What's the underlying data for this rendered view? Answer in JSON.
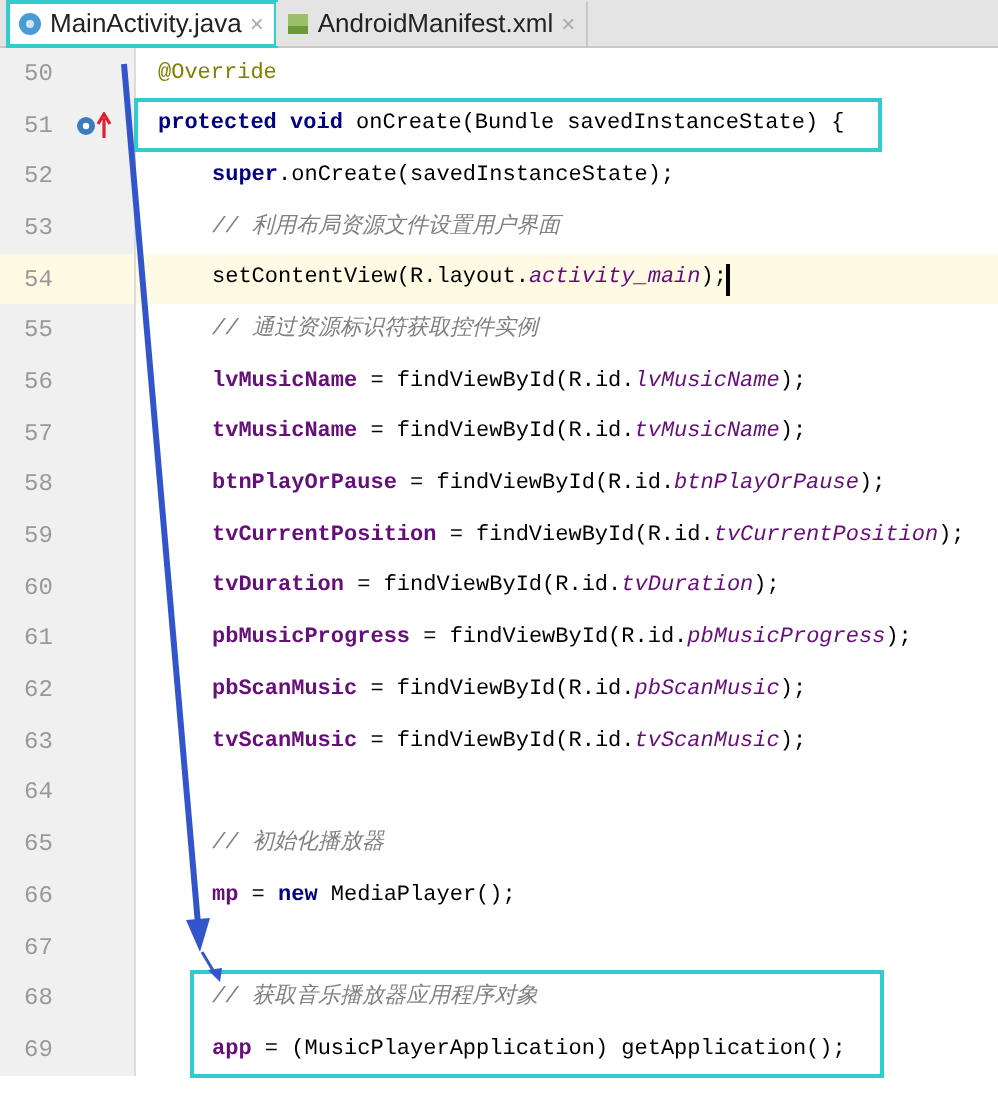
{
  "tabs": [
    {
      "label": "MainActivity.java",
      "close": "×",
      "kind": "java",
      "selected": true,
      "boxed": true
    },
    {
      "label": "AndroidManifest.xml",
      "close": "×",
      "kind": "manifest",
      "selected": false,
      "boxed": false
    }
  ],
  "lines": [
    {
      "number": "50",
      "kind": "declaration",
      "tokens": [
        {
          "text": "@Override",
          "kind": "annotation"
        }
      ]
    },
    {
      "number": "51",
      "kind": "declaration",
      "boxed": true,
      "override_marker": true,
      "tokens": [
        {
          "text": "protected void",
          "kind": "keyword"
        },
        {
          "text": " onCreate(Bundle savedInstanceState) {",
          "kind": "plain"
        }
      ]
    },
    {
      "number": "52",
      "kind": "statement",
      "tokens": [
        {
          "text": "super",
          "kind": "keyword"
        },
        {
          "text": ".onCreate(savedInstanceState);",
          "kind": "plain"
        }
      ]
    },
    {
      "number": "53",
      "kind": "statement",
      "tokens": [
        {
          "text": "// 利用布局资源文件设置用户界面",
          "kind": "comment"
        }
      ]
    },
    {
      "number": "54",
      "kind": "statement",
      "current": true,
      "tokens": [
        {
          "text": "setContentView(R.layout.",
          "kind": "plain"
        },
        {
          "text": "activity_main",
          "kind": "static"
        },
        {
          "text": ");",
          "kind": "plain"
        }
      ]
    },
    {
      "number": "55",
      "kind": "statement",
      "tokens": [
        {
          "text": "// 通过资源标识符获取控件实例",
          "kind": "comment"
        }
      ]
    },
    {
      "number": "56",
      "kind": "statement",
      "tokens": [
        {
          "text": "lvMusicName",
          "kind": "field"
        },
        {
          "text": " = findViewById(R.id.",
          "kind": "plain"
        },
        {
          "text": "lvMusicName",
          "kind": "static"
        },
        {
          "text": ");",
          "kind": "plain"
        }
      ]
    },
    {
      "number": "57",
      "kind": "statement",
      "tokens": [
        {
          "text": "tvMusicName",
          "kind": "field"
        },
        {
          "text": " = findViewById(R.id.",
          "kind": "plain"
        },
        {
          "text": "tvMusicName",
          "kind": "static"
        },
        {
          "text": ");",
          "kind": "plain"
        }
      ]
    },
    {
      "number": "58",
      "kind": "statement",
      "tokens": [
        {
          "text": "btnPlayOrPause",
          "kind": "field"
        },
        {
          "text": " = findViewById(R.id.",
          "kind": "plain"
        },
        {
          "text": "btnPlayOrPause",
          "kind": "static"
        },
        {
          "text": ");",
          "kind": "plain"
        }
      ]
    },
    {
      "number": "59",
      "kind": "statement",
      "tokens": [
        {
          "text": "tvCurrentPosition",
          "kind": "field"
        },
        {
          "text": " = findViewById(R.id.",
          "kind": "plain"
        },
        {
          "text": "tvCurrentPosition",
          "kind": "static"
        },
        {
          "text": ");",
          "kind": "plain"
        }
      ]
    },
    {
      "number": "60",
      "kind": "statement",
      "tokens": [
        {
          "text": "tvDuration",
          "kind": "field"
        },
        {
          "text": " = findViewById(R.id.",
          "kind": "plain"
        },
        {
          "text": "tvDuration",
          "kind": "static"
        },
        {
          "text": ");",
          "kind": "plain"
        }
      ]
    },
    {
      "number": "61",
      "kind": "statement",
      "tokens": [
        {
          "text": "pbMusicProgress",
          "kind": "field"
        },
        {
          "text": " = findViewById(R.id.",
          "kind": "plain"
        },
        {
          "text": "pbMusicProgress",
          "kind": "static"
        },
        {
          "text": ");",
          "kind": "plain"
        }
      ]
    },
    {
      "number": "62",
      "kind": "statement",
      "tokens": [
        {
          "text": "pbScanMusic",
          "kind": "field"
        },
        {
          "text": " = findViewById(R.id.",
          "kind": "plain"
        },
        {
          "text": "pbScanMusic",
          "kind": "static"
        },
        {
          "text": ");",
          "kind": "plain"
        }
      ]
    },
    {
      "number": "63",
      "kind": "statement",
      "tokens": [
        {
          "text": "tvScanMusic",
          "kind": "field"
        },
        {
          "text": " = findViewById(R.id.",
          "kind": "plain"
        },
        {
          "text": "tvScanMusic",
          "kind": "static"
        },
        {
          "text": ");",
          "kind": "plain"
        }
      ]
    },
    {
      "number": "64",
      "kind": "statement"
    },
    {
      "number": "65",
      "kind": "statement",
      "tokens": [
        {
          "text": "// 初始化播放器",
          "kind": "comment"
        }
      ]
    },
    {
      "number": "66",
      "kind": "statement",
      "tokens": [
        {
          "text": "mp",
          "kind": "field"
        },
        {
          "text": " = ",
          "kind": "plain"
        },
        {
          "text": "new",
          "kind": "keyword"
        },
        {
          "text": " MediaPlayer();",
          "kind": "plain"
        }
      ]
    },
    {
      "number": "67",
      "kind": "statement"
    },
    {
      "number": "68",
      "kind": "statement",
      "boxed": true,
      "tokens": [
        {
          "text": "// 获取音乐播放器应用程序对象",
          "kind": "comment"
        }
      ]
    },
    {
      "number": "69",
      "kind": "statement",
      "boxed": true,
      "tokens": [
        {
          "text": "app",
          "kind": "field"
        },
        {
          "text": " = (MusicPlayerApplication) getApplication();",
          "kind": "plain"
        }
      ]
    }
  ]
}
